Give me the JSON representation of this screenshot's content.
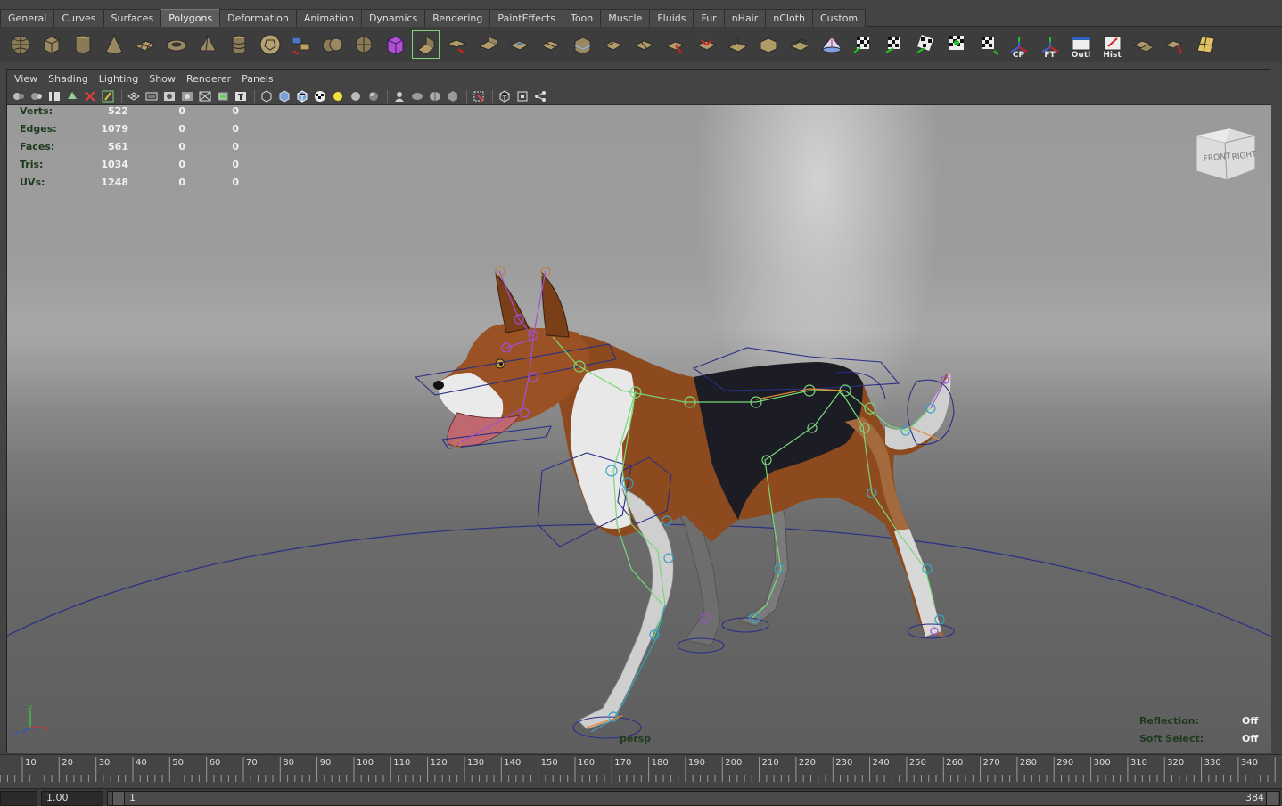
{
  "shelf_tabs": [
    "General",
    "Curves",
    "Surfaces",
    "Polygons",
    "Deformation",
    "Animation",
    "Dynamics",
    "Rendering",
    "PaintEffects",
    "Toon",
    "Muscle",
    "Fluids",
    "Fur",
    "nHair",
    "nCloth",
    "Custom"
  ],
  "active_shelf_tab": "Polygons",
  "shelf_tool_labels": {
    "cp": "CP",
    "ft": "FT",
    "outl": "Outl",
    "hist": "Hist"
  },
  "panel_menu": [
    "View",
    "Shading",
    "Lighting",
    "Show",
    "Renderer",
    "Panels"
  ],
  "hud_stats": [
    {
      "label": "Verts:",
      "values": [
        "522",
        "0",
        "0"
      ]
    },
    {
      "label": "Edges:",
      "values": [
        "1079",
        "0",
        "0"
      ]
    },
    {
      "label": "Faces:",
      "values": [
        "561",
        "0",
        "0"
      ]
    },
    {
      "label": "Tris:",
      "values": [
        "1034",
        "0",
        "0"
      ]
    },
    {
      "label": "UVs:",
      "values": [
        "1248",
        "0",
        "0"
      ]
    }
  ],
  "view_cube": {
    "front": "FRONT",
    "right": "RIGHT"
  },
  "axis_labels": {
    "x": "x",
    "y": "y",
    "z": "z"
  },
  "camera_name": "persp",
  "hud_right": {
    "reflection_label": "Reflection:",
    "reflection_value": "Off",
    "soft_select_label": "Soft Select:",
    "soft_select_value": "Off"
  },
  "timeline_ticks": [
    "10",
    "20",
    "30",
    "40",
    "50",
    "60",
    "70",
    "80",
    "90",
    "100",
    "110",
    "120",
    "130",
    "140",
    "150",
    "160",
    "170",
    "180",
    "190",
    "200",
    "210",
    "220",
    "230",
    "240",
    "250",
    "260",
    "270",
    "280",
    "290",
    "300",
    "310",
    "320",
    "330",
    "340"
  ],
  "range_slider": {
    "start_time": "1.00",
    "range_start": "1",
    "range_end": "384"
  },
  "colors": {
    "joint_green": "#78d878",
    "joint_purple": "#a050d0",
    "control_navy": "#2a2f86",
    "hud_green": "#1e3a1e"
  }
}
